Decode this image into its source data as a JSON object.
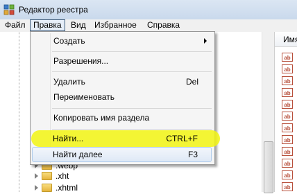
{
  "window": {
    "title": "Редактор реестра"
  },
  "menubar": {
    "items": [
      "Файл",
      "Правка",
      "Вид",
      "Избранное",
      "Справка"
    ],
    "active_index": 1
  },
  "tree": {
    "items": [
      ".webp",
      ".xht",
      ".xhtml"
    ]
  },
  "right_pane": {
    "column_header": "Имя",
    "value_icon": "ab",
    "row_count": 12
  },
  "edit_menu": {
    "create": "Создать",
    "permissions": "Разрешения...",
    "delete": "Удалить",
    "delete_shortcut": "Del",
    "rename": "Переименовать",
    "copy_key_name": "Копировать имя раздела",
    "find": "Найти...",
    "find_shortcut": "CTRL+F",
    "find_next": "Найти далее",
    "find_next_shortcut": "F3"
  },
  "colors": {
    "highlight": "#f2f512",
    "hover_border": "#aecbeb",
    "menu_bg": "#f5f5f5"
  },
  "icons": {
    "app": "registry-editor-icon",
    "submenu": "chevron-right-icon",
    "folder": "folder-icon"
  }
}
